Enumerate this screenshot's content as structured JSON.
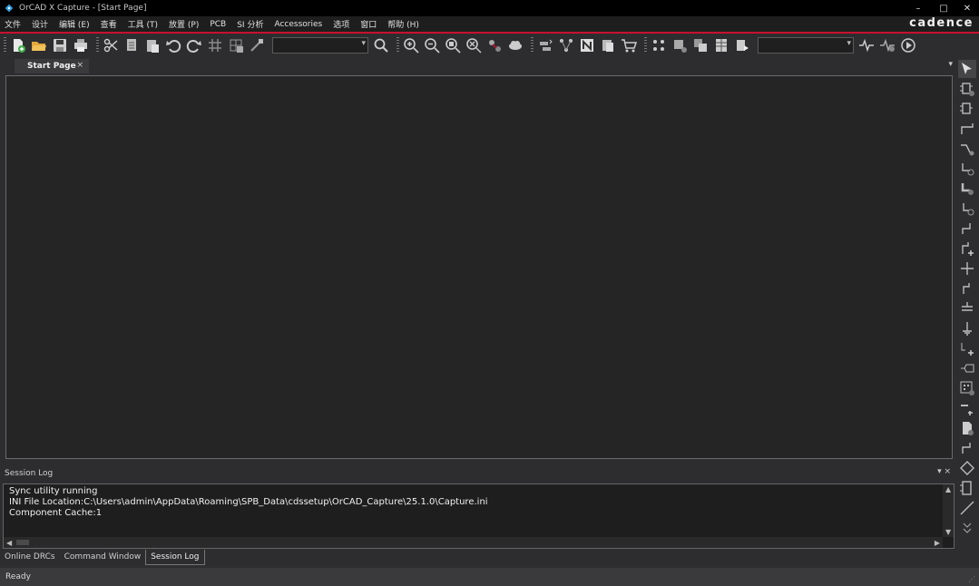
{
  "window": {
    "title": "OrCAD X Capture - [Start Page]",
    "minimize": "–",
    "maximize": "□",
    "close": "✕"
  },
  "menu": {
    "items": [
      "文件",
      "设计",
      "编辑 (E)",
      "查看",
      "工具 (T)",
      "放置 (P)",
      "PCB",
      "SI 分析",
      "Accessories",
      "选项",
      "窗口",
      "帮助 (H)"
    ],
    "brand": "cadence"
  },
  "doc_tabs": {
    "active": "Start Page",
    "close": "×",
    "dropdown": "▾"
  },
  "session_log": {
    "title": "Session Log",
    "header_controls": "▾ ×",
    "lines": [
      "Sync utility running",
      "INI File Location:C:\\Users\\admin\\AppData\\Roaming\\SPB_Data\\cdssetup\\OrCAD_Capture\\25.1.0\\Capture.ini",
      "Component Cache:1"
    ]
  },
  "bottom_tabs": [
    "Online DRCs",
    "Command Window",
    "Session Log"
  ],
  "status": {
    "text": "Ready"
  },
  "colors": {
    "accent": "#c8102e",
    "canvas": "#252526",
    "chrome": "#2d2d30"
  }
}
